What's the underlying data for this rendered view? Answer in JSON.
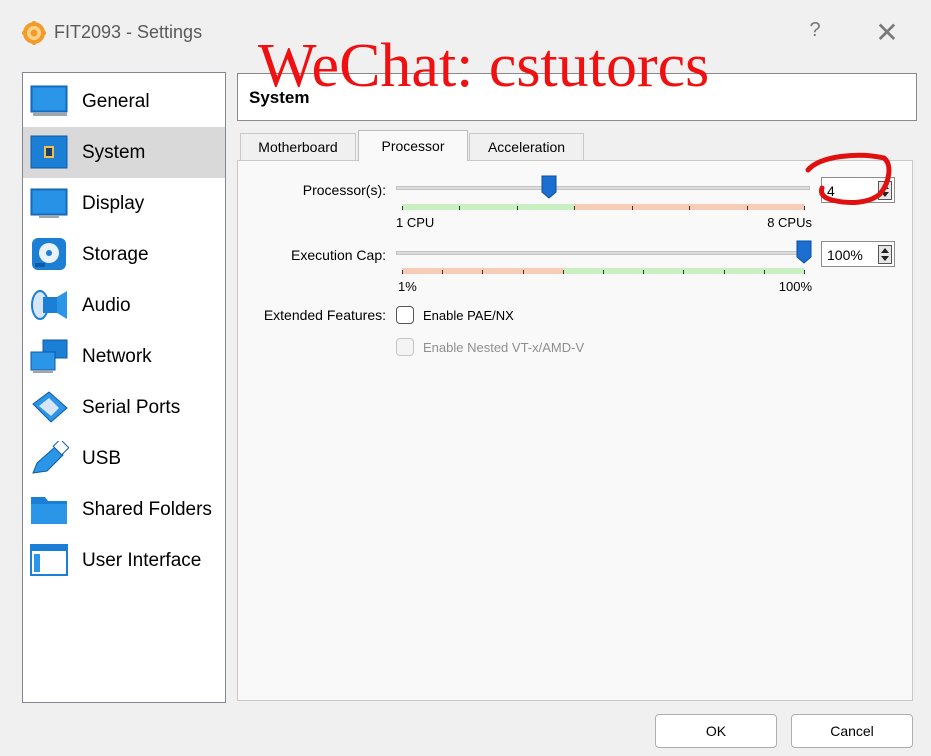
{
  "window": {
    "title": "FIT2093 - Settings",
    "help_label": "?",
    "close_label": "✕"
  },
  "sidebar": {
    "items": [
      {
        "label": "General",
        "icon": "general-icon"
      },
      {
        "label": "System",
        "icon": "chip-icon",
        "selected": true
      },
      {
        "label": "Display",
        "icon": "monitor-icon"
      },
      {
        "label": "Storage",
        "icon": "disc-icon"
      },
      {
        "label": "Audio",
        "icon": "speaker-icon"
      },
      {
        "label": "Network",
        "icon": "network-icon"
      },
      {
        "label": "Serial Ports",
        "icon": "serial-port-icon"
      },
      {
        "label": "USB",
        "icon": "usb-icon"
      },
      {
        "label": "Shared Folders",
        "icon": "folder-icon"
      },
      {
        "label": "User Interface",
        "icon": "window-icon"
      }
    ]
  },
  "header": {
    "title": "System"
  },
  "tabs": [
    {
      "label": "Motherboard"
    },
    {
      "label": "Processor",
      "active": true
    },
    {
      "label": "Acceleration"
    }
  ],
  "processor": {
    "label": "Processor(s):",
    "value": "4",
    "min_label": "1 CPU",
    "max_label": "8 CPUs",
    "min": 1,
    "max": 8,
    "current": 4
  },
  "execution_cap": {
    "label": "Execution Cap:",
    "value": "100%",
    "min_label": "1%",
    "max_label": "100%",
    "current_percent": 100
  },
  "extended_features": {
    "label": "Extended Features:",
    "pae_label": "Enable PAE/NX",
    "pae_checked": false,
    "nested_label": "Enable Nested VT-x/AMD-V",
    "nested_enabled": false
  },
  "buttons": {
    "ok": "OK",
    "cancel": "Cancel"
  },
  "watermark": {
    "text": "WeChat: cstutorcs"
  },
  "colors": {
    "accent": "#1a6fd1",
    "selection": "#d9d9d9",
    "good_range": "#c8f0c0",
    "bad_range": "#f7cdb8",
    "annotation": "#e01010"
  }
}
